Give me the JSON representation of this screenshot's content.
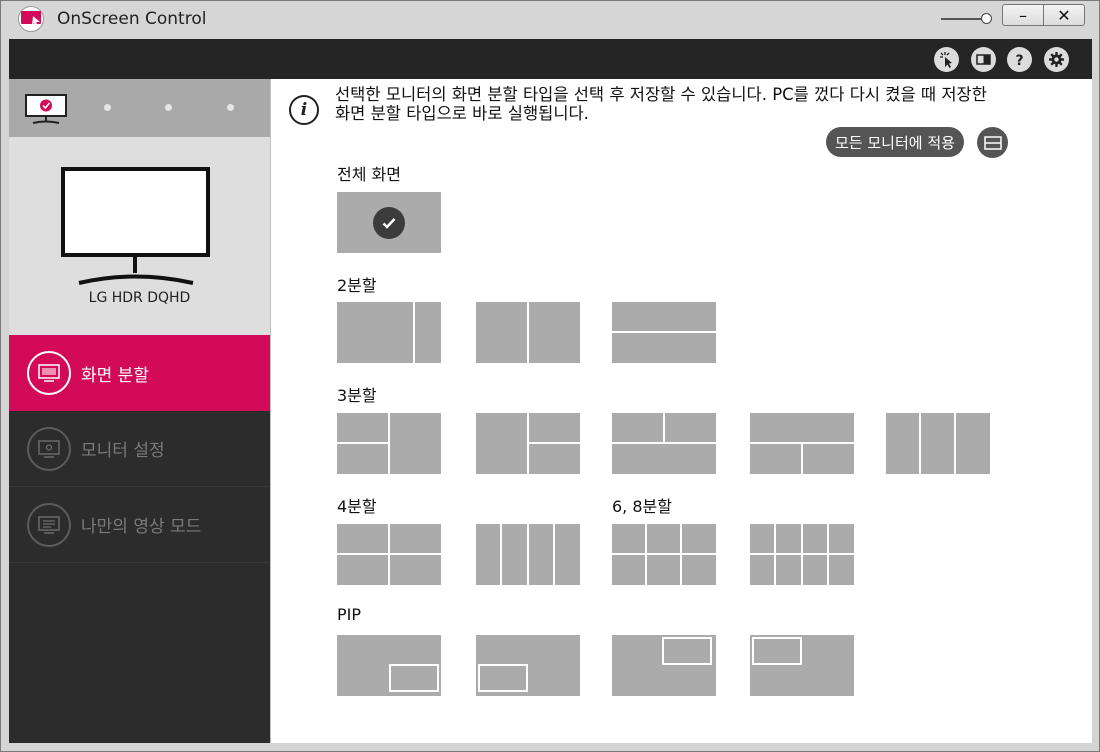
{
  "window": {
    "title": "OnScreen Control"
  },
  "toolbar": {
    "icons": [
      "cursor-icon",
      "screen-icon",
      "help-icon",
      "settings-icon"
    ]
  },
  "sidebar": {
    "monitor_name": "LG HDR DQHD",
    "menu": [
      {
        "label": "화면 분할",
        "icon": "screen-split-icon",
        "active": true
      },
      {
        "label": "모니터 설정",
        "icon": "monitor-settings-icon",
        "active": false
      },
      {
        "label": "나만의 영상 모드",
        "icon": "picture-mode-icon",
        "active": false
      }
    ]
  },
  "main": {
    "info_line1": "선택한 모니터의 화면 분할 타입을 선택 후 저장할 수 있습니다. PC를 껐다 다시 켰을 때 저장한",
    "info_line2": "화면 분할 타입으로 바로 실행됩니다.",
    "apply_all_label": "모든 모니터에 적용",
    "sections": {
      "full": "전체 화면",
      "split2": "2분할",
      "split3": "3분할",
      "split4": "4분할",
      "split68": "6, 8분할",
      "pip": "PIP"
    }
  },
  "colors": {
    "accent": "#d20a58",
    "tile": "#ababab",
    "sidebar": "#2c2c2c"
  }
}
